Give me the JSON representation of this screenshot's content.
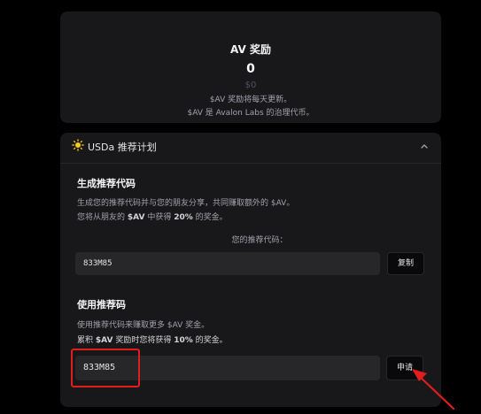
{
  "reward": {
    "title": "AV 奖励",
    "amount": "0",
    "usd": "$0",
    "note_1": "$AV 奖励将每天更新。",
    "note_2": "$AV 是 Avalon Labs 的治理代币。"
  },
  "program": {
    "title": "USDa 推荐计划",
    "icon": "sun-icon",
    "collapse_icon": "chevron-up-icon",
    "generate": {
      "title": "生成推荐代码",
      "desc_1": "生成您的推荐代码并与您的朋友分享，共同赚取额外的 $AV。",
      "desc_2_prefix": "您将从朋友的 ",
      "desc_2_token": "$AV",
      "desc_2_mid": " 中获得 ",
      "desc_2_pct": "20%",
      "desc_2_suffix": " 的奖金。",
      "code_label": "您的推荐代码：",
      "code_value": "833M85",
      "copy_label": "复制"
    },
    "use": {
      "title": "使用推荐码",
      "desc_1": "使用推荐代码来赚取更多 $AV 奖金。",
      "desc_2_prefix": "累积 ",
      "desc_2_token": "$AV",
      "desc_2_mid": " 奖励时您将获得 ",
      "desc_2_pct": "10%",
      "desc_2_suffix": " 的奖金。",
      "input_value": "833M85",
      "apply_label": "申请"
    }
  },
  "colors": {
    "background": "#000000",
    "card": "#18181b",
    "input": "#27272a",
    "highlight": "#e11d1d",
    "sun": "#facc15"
  }
}
